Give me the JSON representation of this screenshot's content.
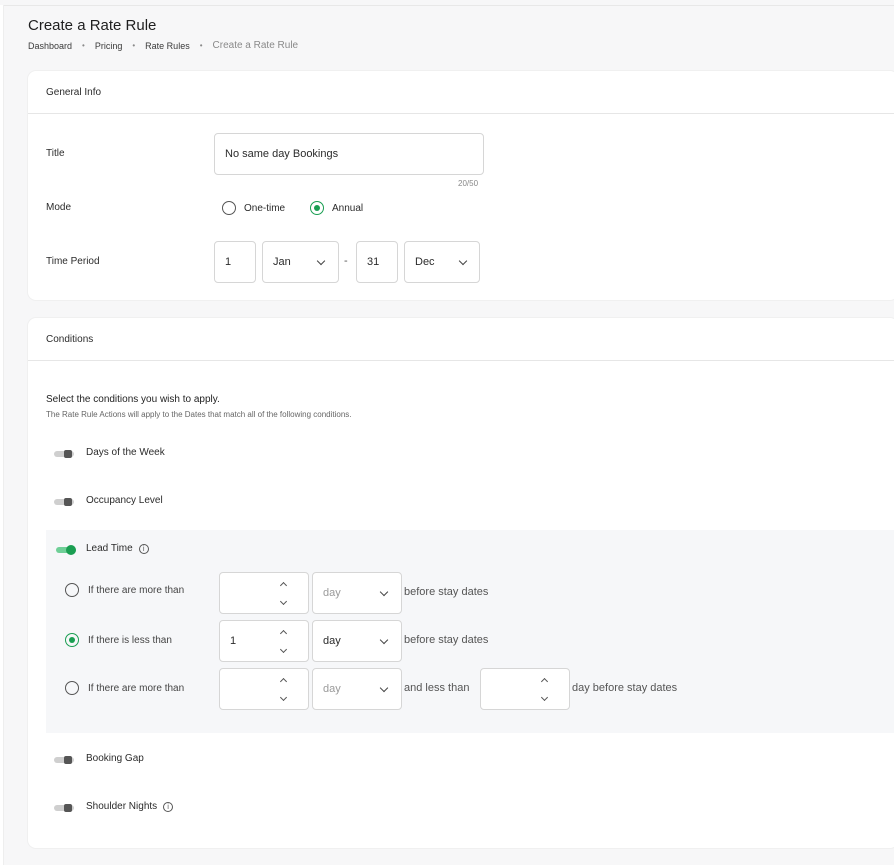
{
  "page": {
    "title": "Create a Rate Rule"
  },
  "breadcrumb": [
    "Dashboard",
    "Pricing",
    "Rate Rules",
    "Create a Rate Rule"
  ],
  "general": {
    "header": "General Info",
    "title_label": "Title",
    "title_value": "No same day Bookings",
    "title_counter": "20/50",
    "mode_label": "Mode",
    "mode_options": [
      "One-time",
      "Annual"
    ],
    "mode_selected": "Annual",
    "period_label": "Time Period",
    "period_start_day": "1",
    "period_start_month": "Jan",
    "period_separator": "-",
    "period_end_day": "31",
    "period_end_month": "Dec"
  },
  "conditions": {
    "header": "Conditions",
    "intro": "Select the conditions you wish to apply.",
    "subtext": "The Rate Rule Actions will apply to the Dates that match all of the following conditions.",
    "toggles": {
      "days_of_week": {
        "label": "Days of the Week",
        "on": false
      },
      "occupancy_level": {
        "label": "Occupancy Level",
        "on": false
      },
      "lead_time": {
        "label": "Lead Time",
        "on": true
      },
      "booking_gap": {
        "label": "Booking Gap",
        "on": false
      },
      "shoulder_nights": {
        "label": "Shoulder Nights",
        "on": false
      }
    },
    "lead_time": {
      "option1": {
        "label": "If there are more than",
        "value": "",
        "unit": "day",
        "after": "before stay dates"
      },
      "option2": {
        "label": "If there is less than",
        "value": "1",
        "unit": "day",
        "after": "before stay dates"
      },
      "option3": {
        "label": "If there are more than",
        "value": "",
        "unit": "day",
        "middle": "and less than",
        "value2": "",
        "after": "day before stay dates"
      },
      "selected": "option2"
    }
  },
  "icons": {
    "info": "info-icon",
    "chevron": "chevron-down-icon"
  },
  "colors": {
    "accent": "#1a9e52",
    "accent_light": "#6fcf97"
  }
}
